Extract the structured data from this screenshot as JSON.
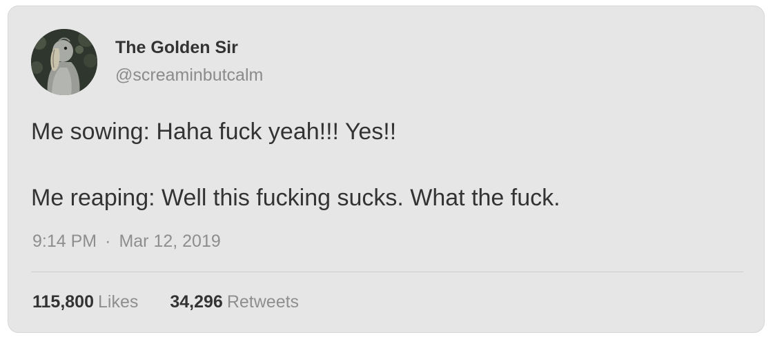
{
  "author": {
    "name": "The Golden Sir",
    "handle": "@screaminbutcalm"
  },
  "tweet": {
    "lines": [
      "Me sowing: Haha fuck yeah!!! Yes!!",
      "Me reaping: Well this fucking sucks. What the fuck."
    ],
    "time": "9:14 PM",
    "separator": "·",
    "date": "Mar 12, 2019"
  },
  "stats": {
    "likes_count": "115,800",
    "likes_label": "Likes",
    "retweets_count": "34,296",
    "retweets_label": "Retweets"
  },
  "colors": {
    "card_background": "#e6e6e6",
    "text_primary": "#333333",
    "text_secondary": "#8e8e8e"
  },
  "icons": {
    "avatar": "shoebill-bird-photo"
  }
}
